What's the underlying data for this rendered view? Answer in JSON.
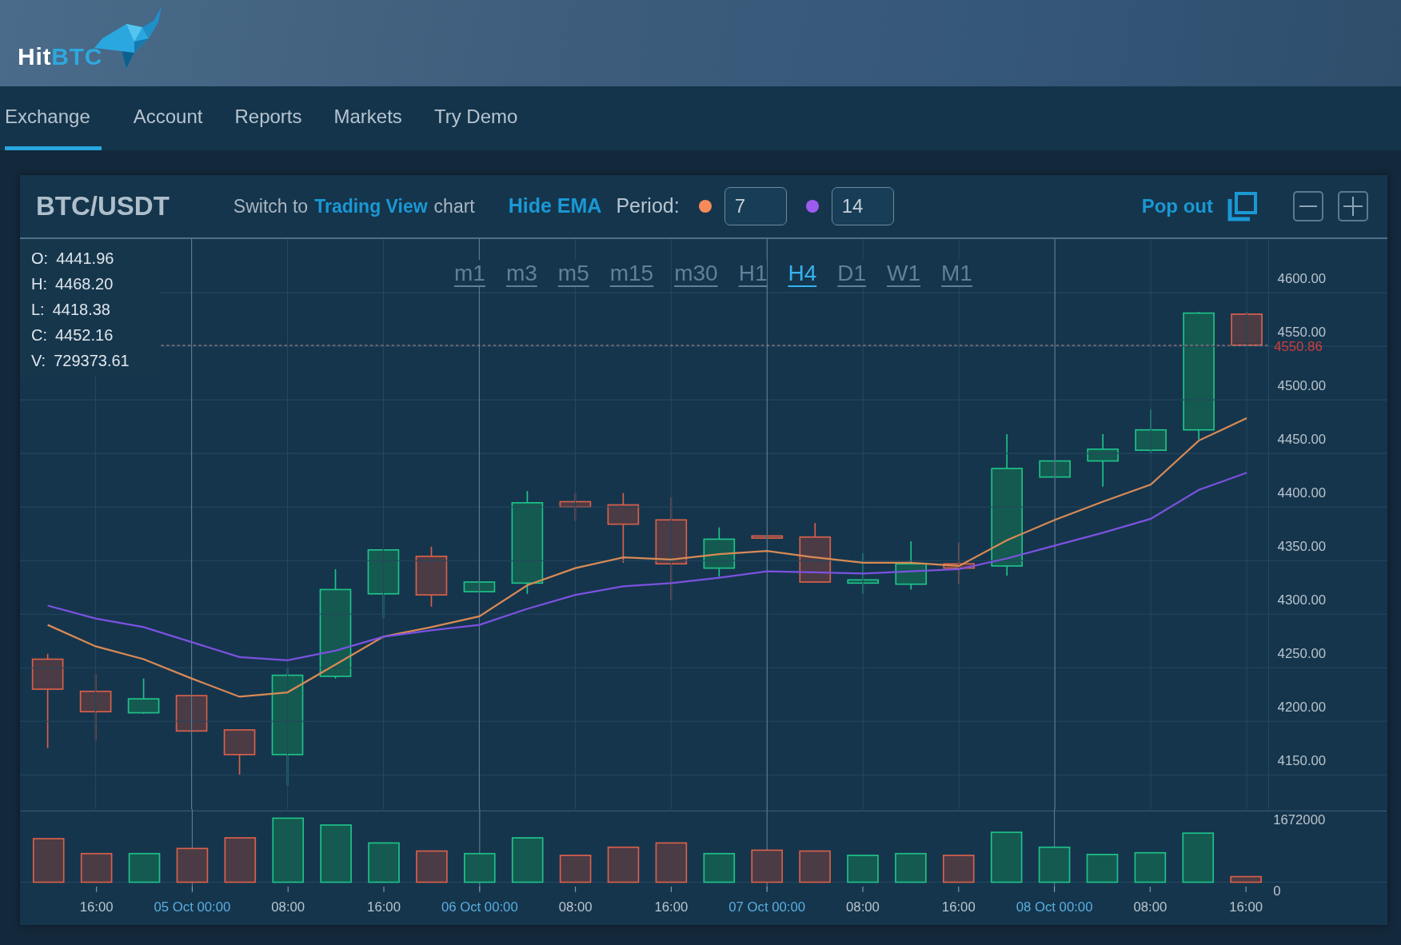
{
  "logo": {
    "first": "Hit",
    "second": "BTC"
  },
  "nav": [
    {
      "label": "Exchange",
      "selected": true
    },
    {
      "label": "Account",
      "selected": false
    },
    {
      "label": "Reports",
      "selected": false
    },
    {
      "label": "Markets",
      "selected": false
    },
    {
      "label": "Try Demo",
      "selected": false
    }
  ],
  "toolbar": {
    "pair": "BTC/USDT",
    "switch_prefix": "Switch to",
    "switch_link": "Trading View",
    "switch_suffix": "chart",
    "hide_ema": "Hide EMA",
    "period_label": "Period:",
    "ema_inputs": [
      {
        "color": "#f58b5a",
        "value": "7"
      },
      {
        "color": "#9c5cf0",
        "value": "14"
      }
    ],
    "pop_out": "Pop out"
  },
  "ohlc": [
    {
      "label": "O:",
      "value": "4441.96"
    },
    {
      "label": "H:",
      "value": "4468.20"
    },
    {
      "label": "L:",
      "value": "4418.38"
    },
    {
      "label": "C:",
      "value": "4452.16"
    },
    {
      "label": "V:",
      "value": "729373.61"
    }
  ],
  "timeframes": [
    {
      "label": "m1",
      "selected": false
    },
    {
      "label": "m3",
      "selected": false
    },
    {
      "label": "m5",
      "selected": false
    },
    {
      "label": "m15",
      "selected": false
    },
    {
      "label": "m30",
      "selected": false
    },
    {
      "label": "H1",
      "selected": false
    },
    {
      "label": "H4",
      "selected": true
    },
    {
      "label": "D1",
      "selected": false
    },
    {
      "label": "W1",
      "selected": false
    },
    {
      "label": "M1",
      "selected": false
    }
  ],
  "price_chart": {
    "chart_data": {
      "type": "line",
      "grid": true,
      "ylim": [
        4118,
        4650
      ],
      "yticks": [
        {
          "value": 4600,
          "label": "4600.00"
        },
        {
          "value": 4550,
          "label": "4550.00"
        },
        {
          "value": 4500,
          "label": "4500.00"
        },
        {
          "value": 4450,
          "label": "4450.00"
        },
        {
          "value": 4400,
          "label": "4400.00"
        },
        {
          "value": 4350,
          "label": "4350.00"
        },
        {
          "value": 4300,
          "label": "4300.00"
        },
        {
          "value": 4250,
          "label": "4250.00"
        },
        {
          "value": 4200,
          "label": "4200.00"
        },
        {
          "value": 4150,
          "label": "4150.00"
        }
      ],
      "series": [
        {
          "color": "#d98a55",
          "values": [
            4290,
            4270,
            4258,
            4240,
            4223,
            4227,
            4253,
            4279,
            4288,
            4298,
            4327,
            4343,
            4353,
            4351,
            4356,
            4359,
            4353,
            4348,
            4348,
            4345,
            4369,
            4388,
            4405,
            4421,
            4462,
            4483
          ]
        },
        {
          "color": "#7b52e0",
          "values": [
            4308,
            4296,
            4288,
            4274,
            4260,
            4257,
            4266,
            4279,
            4285,
            4290,
            4305,
            4318,
            4326,
            4329,
            4334,
            4340,
            4339,
            4338,
            4340,
            4342,
            4352,
            4364,
            4376,
            4389,
            4416,
            4432
          ]
        }
      ],
      "ref_lines": [
        {
          "axis": "y",
          "value": 4550.86,
          "label": "4550.86"
        }
      ]
    }
  },
  "volume_chart": {
    "chart_data": {
      "type": "bar",
      "grid": true,
      "ylim": [
        0,
        1672000
      ],
      "categories": [
        null,
        "16:00",
        null,
        "05 Oct 00:00",
        null,
        "08:00",
        null,
        "16:00",
        null,
        "06 Oct 00:00",
        null,
        "08:00",
        null,
        "16:00",
        null,
        "07 Oct 00:00",
        null,
        "08:00",
        null,
        "16:00",
        null,
        "08 Oct 00:00",
        null,
        "08:00",
        null,
        "16:00"
      ],
      "yticks": [
        {
          "value": 1672000,
          "label": "1672000"
        },
        {
          "value": 0,
          "label": "0"
        }
      ],
      "series": [
        {
          "values": [
            1020000,
            670000,
            670000,
            790000,
            1040000,
            1500000,
            1340000,
            920000,
            730000,
            670000,
            1040000,
            630000,
            820000,
            920000,
            670000,
            750000,
            730000,
            630000,
            670000,
            630000,
            1170000,
            820000,
            650000,
            690000,
            1150000,
            130000
          ]
        }
      ]
    }
  }
}
